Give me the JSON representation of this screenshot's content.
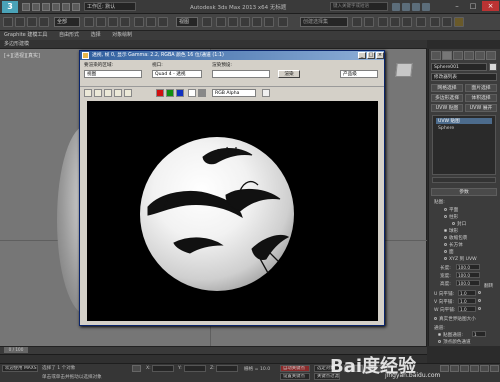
{
  "app": {
    "logo_text": "3",
    "title": "Autodesk 3ds Max  2013 x64   无标题",
    "workspace": "工作区: 默认",
    "search_placeholder": "键入关键字或短语"
  },
  "toolbar": {
    "selection_filter": "全部",
    "view_dropdown": "视图",
    "named_selection": "创建选择集"
  },
  "ribbon": {
    "tabs": [
      "Graphite 建模工具",
      "自由形式",
      "选择",
      "对象绘制"
    ],
    "sub_label": "多边形建模"
  },
  "viewport": {
    "label": "[+][透视][真实]"
  },
  "frame_buffer": {
    "title": "透视, 帧 0, 显示 Gamma: 2.2, RGBA 颜色 16 位/通道 (1:1)",
    "area_label": "要渲染的区域:",
    "area_value": "视图",
    "viewport_label": "视口:",
    "viewport_value": "Quad 4 - 透视",
    "preset_label": "渲染预设:",
    "preset_value": "",
    "render_button": "渲染",
    "production_value": "产品级",
    "channel_value": "RGB Alpha",
    "colors": {
      "red": "#d01010",
      "green": "#109010",
      "blue": "#1030c0"
    }
  },
  "command_panel": {
    "object_name": "Sphere001",
    "modifier_list": "修改器列表",
    "buttons": [
      "网格选择",
      "面片选择",
      "多边形选择",
      "体积选择",
      "UVW 贴图",
      "UVW 展开"
    ],
    "stack": [
      "UVW 贴图",
      "Sphere"
    ],
    "rollout_title": "参数",
    "mapping_label": "贴图:",
    "mapping_options": [
      "平面",
      "柱形",
      "封口",
      "球形",
      "收缩包裹",
      "长方体",
      "面",
      "XYZ 到 UVW"
    ],
    "mapping_selected": 3,
    "length_label": "长度:",
    "length_value": "100.0",
    "width_label": "宽度:",
    "width_value": "100.0",
    "height_label": "高度:",
    "height_value": "100.0",
    "u_tile_label": "U 向平铺:",
    "u_tile_value": "1.0",
    "v_tile_label": "V 向平铺:",
    "v_tile_value": "1.0",
    "w_tile_label": "W 向平铺:",
    "w_tile_value": "1.0",
    "flip_label": "翻转",
    "real_world_label": "真实世界贴图大小",
    "channel_label": "通道:",
    "map_channel_label": "贴图通道:",
    "map_channel_value": "1",
    "vertex_color_label": "顶点颜色通道"
  },
  "timeline": {
    "frame": "0 / 100"
  },
  "status": {
    "selected": "选择了 1 个对象",
    "prompt": "单击或单击并拖动以选择对象",
    "welcome": "欢迎使用 MAXS",
    "x_label": "X:",
    "y_label": "Y:",
    "z_label": "Z:",
    "grid_label": "栅格 = 10.0",
    "autokey": "自动关键点",
    "set_key": "设置关键点",
    "key_filter": "选定对象",
    "key_filter_btn": "关键点过滤器..."
  },
  "watermark": {
    "text": "Bai度经验",
    "sub": "jingyan.baidu.com"
  }
}
